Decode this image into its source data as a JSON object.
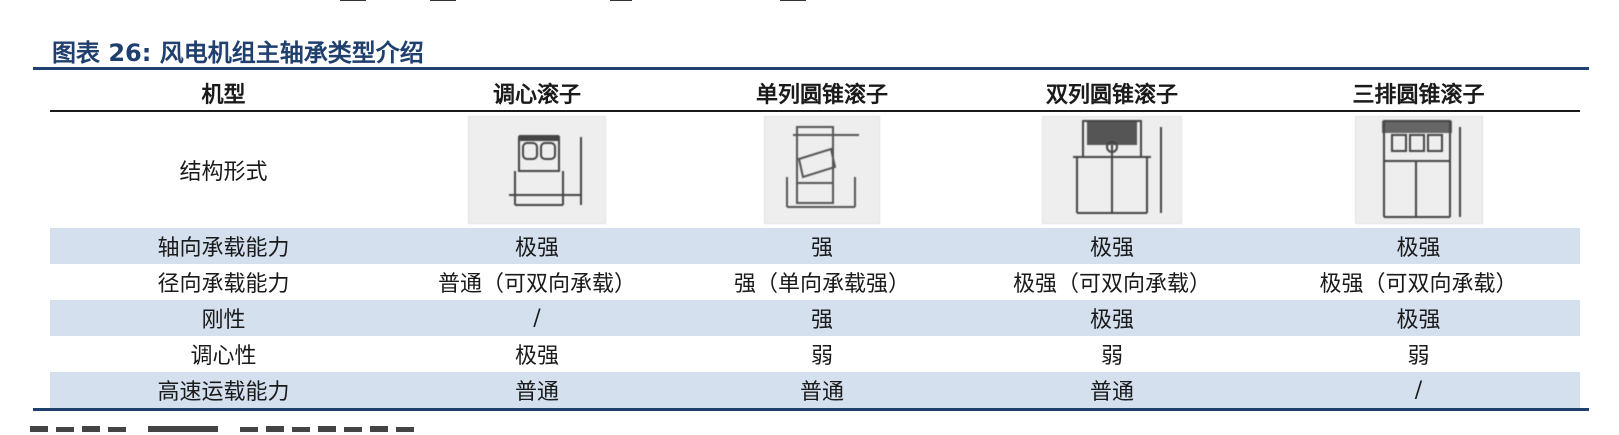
{
  "caption": "图表 26: 风电机组主轴承类型介绍",
  "table": {
    "headers": [
      "机型",
      "调心滚子",
      "单列圆锥滚子",
      "双列圆锥滚子",
      "三排圆锥滚子"
    ],
    "structure_label": "结构形式",
    "rows": [
      [
        "轴向承载能力",
        "极强",
        "强",
        "极强",
        "极强"
      ],
      [
        "径向承载能力",
        "普通（可双向承载）",
        "强（单向承载强）",
        "极强（可双向承载）",
        "极强（可双向承载）"
      ],
      [
        "刚性",
        "/",
        "强",
        "极强",
        "极强"
      ],
      [
        "调心性",
        "极强",
        "弱",
        "弱",
        "弱"
      ],
      [
        "高速运载能力",
        "普通",
        "普通",
        "普通",
        "/"
      ]
    ]
  },
  "icons": [
    "spherical-roller-bearing-diagram",
    "single-row-tapered-roller-bearing-diagram",
    "double-row-tapered-roller-bearing-diagram",
    "three-row-tapered-roller-bearing-diagram"
  ],
  "colors": {
    "accent": "#1f3f6e",
    "band": "#d4e0ee"
  }
}
